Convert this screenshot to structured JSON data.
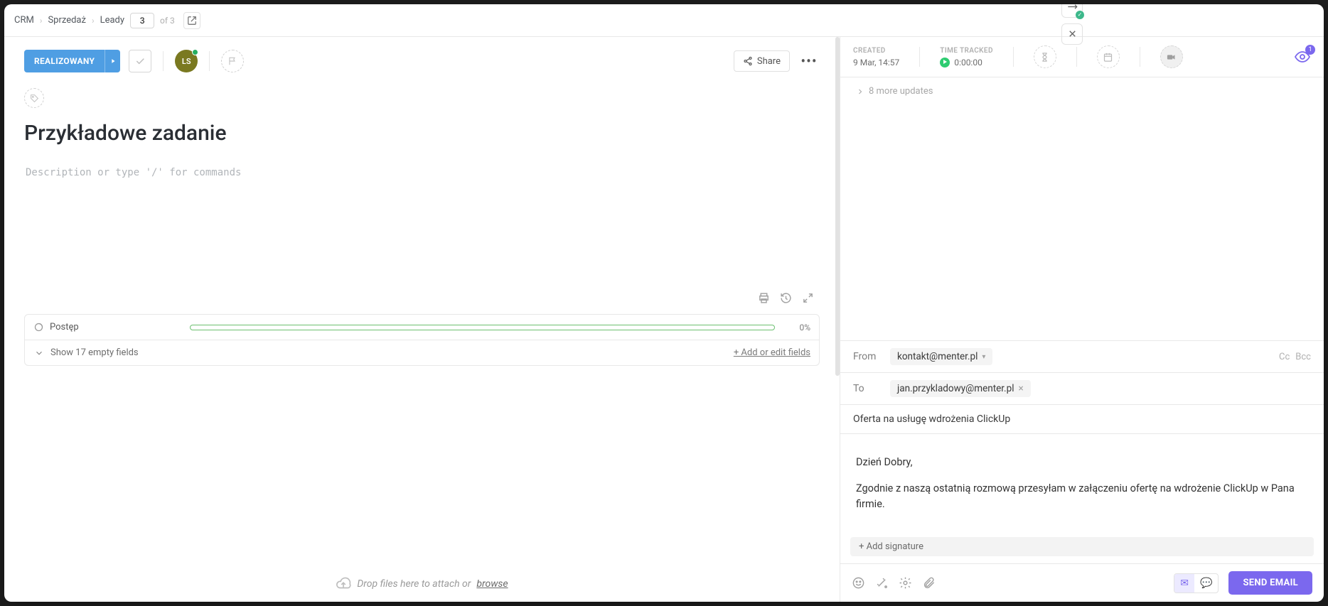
{
  "breadcrumb": {
    "a": "CRM",
    "b": "Sprzedaż",
    "c": "Leady",
    "page": "3",
    "of": "of 3"
  },
  "status": {
    "label": "REALIZOWANY"
  },
  "avatar": {
    "initials": "LS"
  },
  "share": {
    "label": "Share"
  },
  "task": {
    "title": "Przykładowe zadanie",
    "desc_placeholder": "Description or type '/' for commands"
  },
  "fields": {
    "progress_label": "Postęp",
    "progress_pct": "0%",
    "show_label": "Show 17 empty fields",
    "add_label": "+ Add or edit fields"
  },
  "drop": {
    "text": "Drop files here to attach or ",
    "link": "browse"
  },
  "meta": {
    "created_label": "CREATED",
    "created_value": "9 Mar, 14:57",
    "tt_label": "TIME TRACKED",
    "tt_value": "0:00:00"
  },
  "watch_count": "1",
  "more_updates": "8 more updates",
  "email": {
    "from_label": "From",
    "from_value": "kontakt@menter.pl",
    "to_label": "To",
    "to_value": "jan.przykladowy@menter.pl",
    "cc": "Cc",
    "bcc": "Bcc",
    "subject": "Oferta na usługę wdrożenia ClickUp",
    "body_greeting": "Dzień Dobry,",
    "body_text": "Zgodnie z naszą ostatnią rozmową przesyłam w załączeniu ofertę na wdrożenie ClickUp w Pana firmie.",
    "signature": "+ Add signature",
    "send": "SEND EMAIL"
  }
}
